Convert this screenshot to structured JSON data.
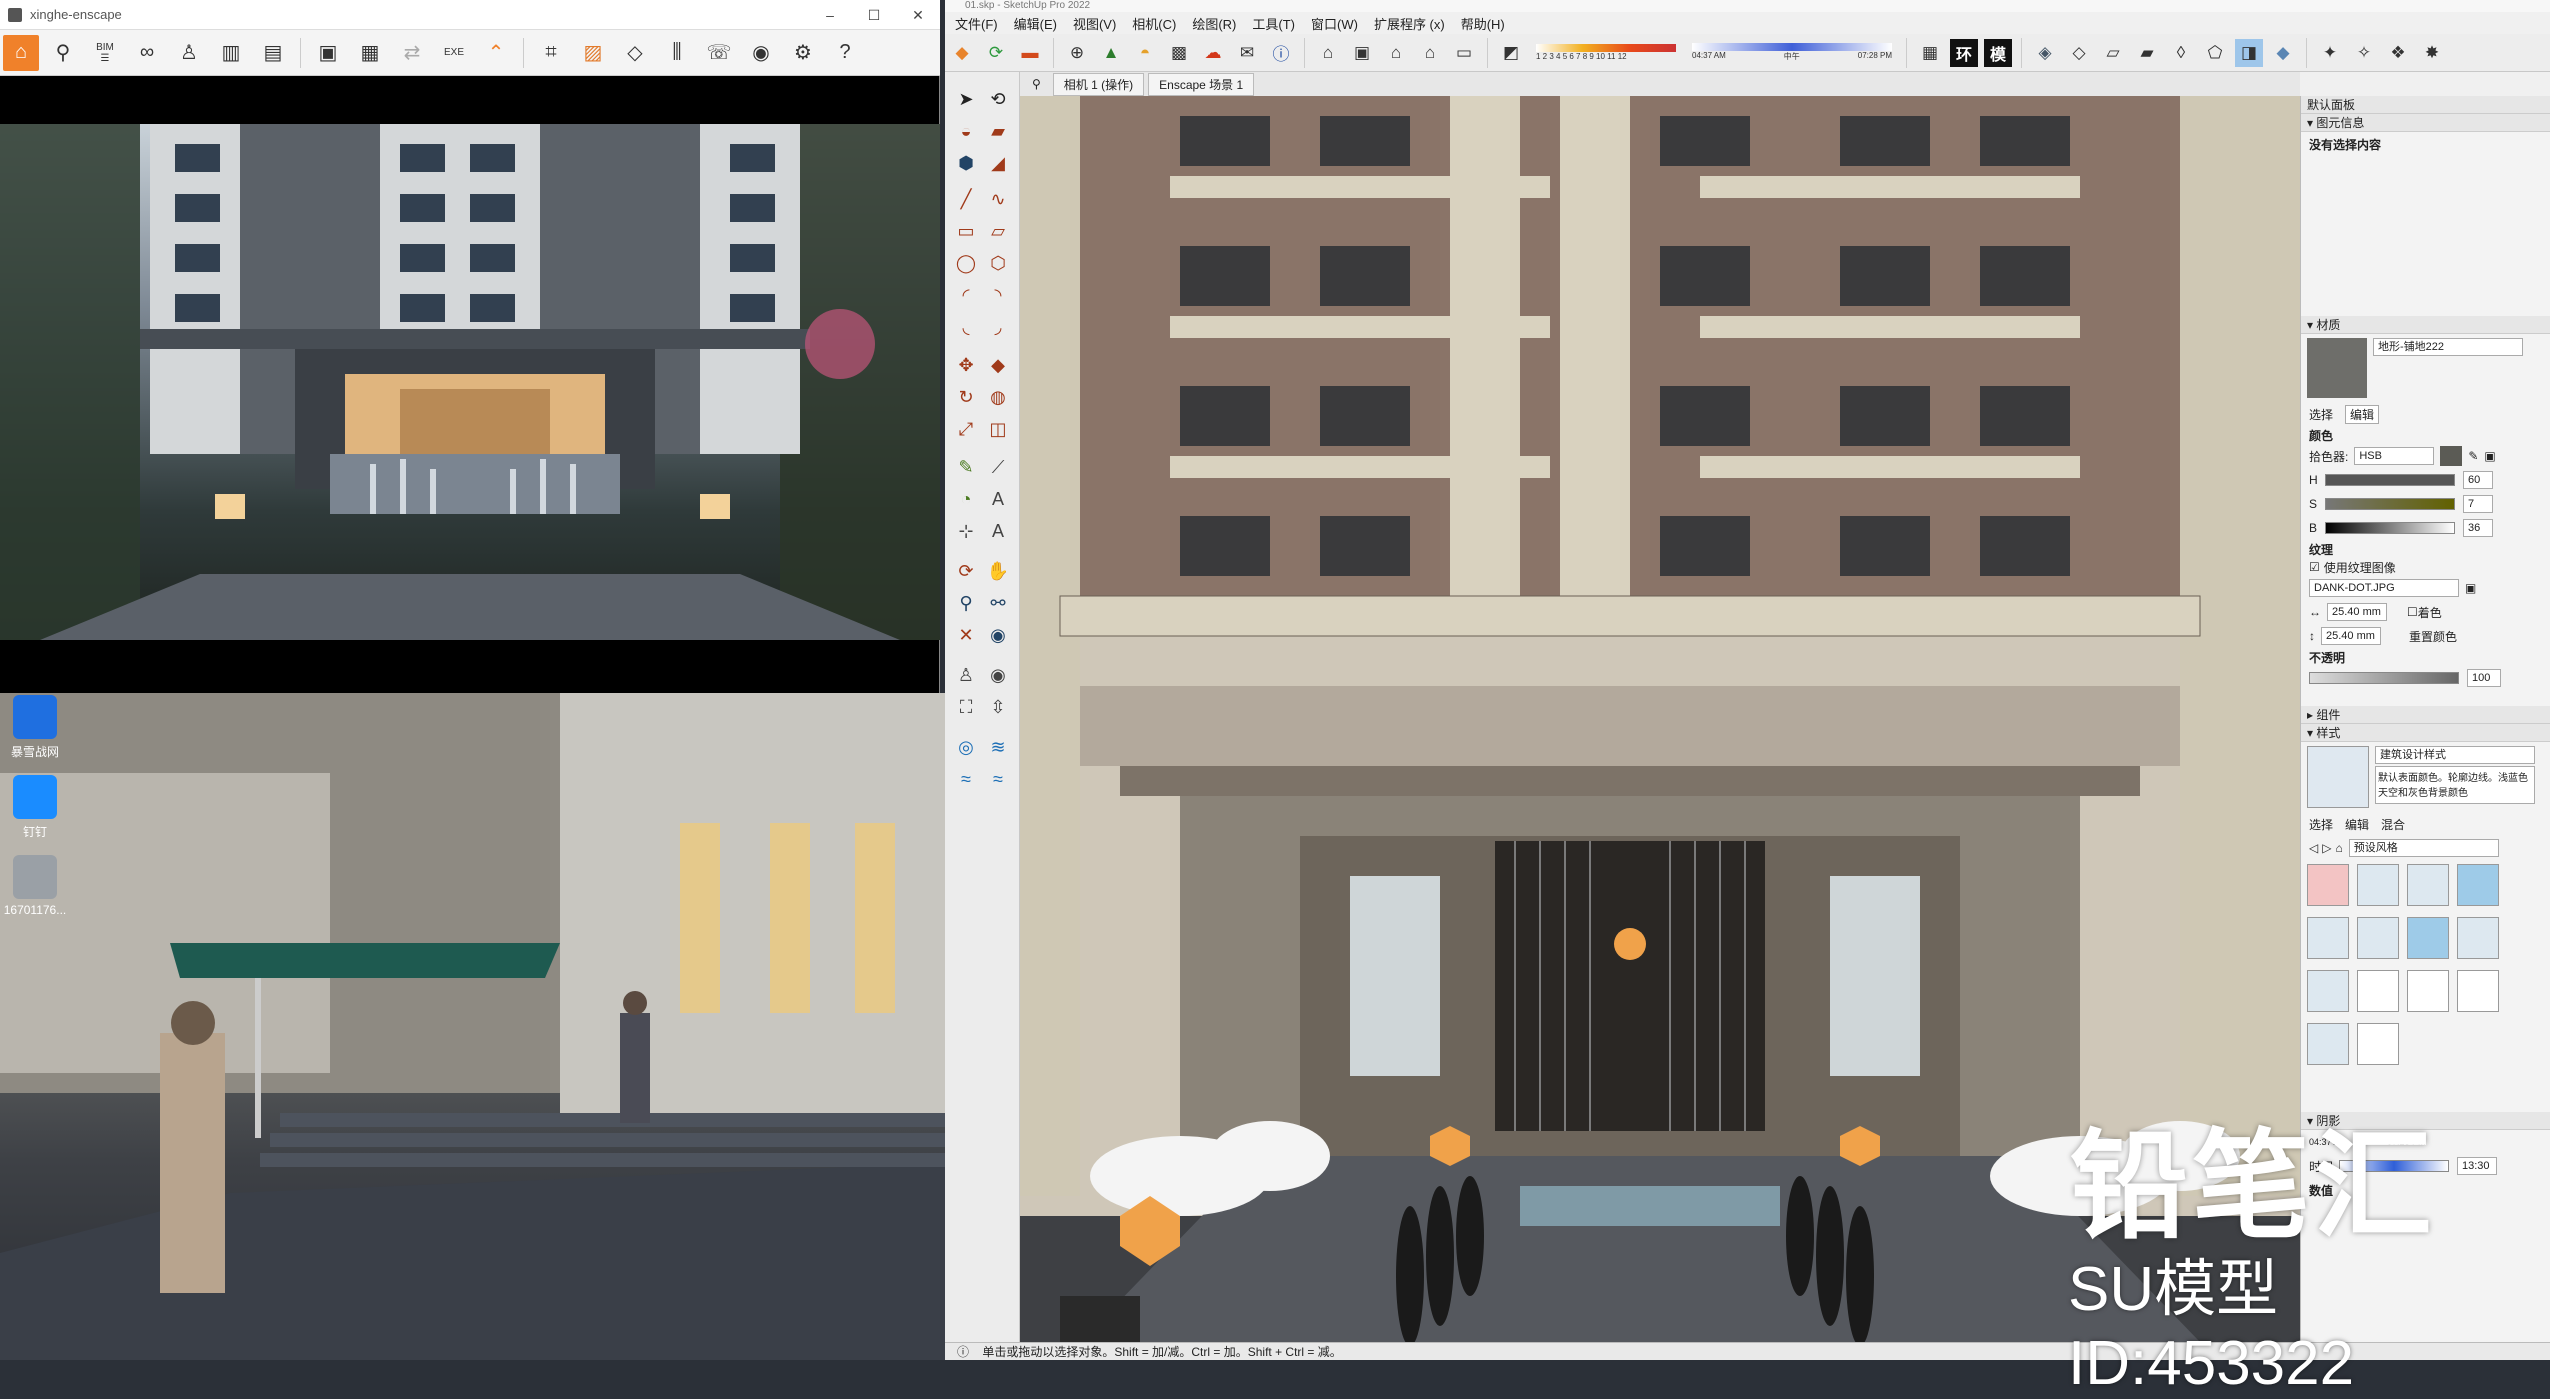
{
  "enscape": {
    "title": "xinghe-enscape",
    "minimize": "–",
    "maximize": "☐",
    "close": "✕",
    "toolbar_icons": [
      "home-icon",
      "pin-icon",
      "bim-icon",
      "binoculars-icon",
      "person-icon",
      "building-icon",
      "clapper-icon",
      "screenshot-icon",
      "batch-render-icon",
      "panorama-icon",
      "exe-export-icon",
      "collapse-icon",
      "map-icon",
      "asset-library-icon",
      "cube-icon",
      "library-icon",
      "chat-icon",
      "eye-icon",
      "gear-icon",
      "help-icon"
    ],
    "bim_label": "BIM",
    "exe_label": "EXE"
  },
  "desktop": {
    "icons": [
      {
        "label": "暴雪战网"
      },
      {
        "label": "钉钉"
      },
      {
        "label": "16701176..."
      }
    ]
  },
  "sketchup": {
    "title": "01.skp - SketchUp Pro 2022",
    "menu": [
      "文件(F)",
      "编辑(E)",
      "视图(V)",
      "相机(C)",
      "绘图(R)",
      "工具(T)",
      "窗口(W)",
      "扩展程序 (x)",
      "帮助(H)"
    ],
    "scene_tabs": [
      "相机 1 (操作)",
      "Enscape 场景 1"
    ],
    "time_labels": {
      "months": "1  2  3  4  5  6  7  8  9  10  11  12",
      "start": "04:37 AM",
      "mid": "中午",
      "end": "07:28 PM"
    },
    "toolbar_letters": [
      "环",
      "模"
    ],
    "status": "单击或拖动以选择对象。Shift = 加/减。Ctrl = 加。Shift + Ctrl = 减。"
  },
  "tray": {
    "title": "默认面板",
    "entity_info": {
      "header": "图元信息",
      "text": "没有选择内容"
    },
    "materials": {
      "header": "材质",
      "name": "地形-铺地222",
      "tabs": [
        "选择",
        "编辑"
      ],
      "color_label": "颜色",
      "picker_label": "拾色器:",
      "picker_value": "HSB",
      "h": {
        "label": "H",
        "value": "60"
      },
      "s": {
        "label": "S",
        "value": "7"
      },
      "b": {
        "label": "B",
        "value": "36"
      },
      "texture_label": "纹理",
      "use_texture": "使用纹理图像",
      "texture_file": "DANK-DOT.JPG",
      "width": "25.40 mm",
      "height": "25.40 mm",
      "colorize": "着色",
      "reset_color": "重置颜色",
      "opacity_label": "不透明",
      "opacity_value": "100"
    },
    "components": {
      "header": "组件"
    },
    "styles": {
      "header": "样式",
      "name": "建筑设计样式",
      "desc": "默认表面颜色。轮廓边线。浅蓝色天空和灰色背景颜色",
      "tabs": [
        "选择",
        "编辑",
        "混合"
      ],
      "dropdown": "预设风格"
    },
    "shadows": {
      "header": "阴影",
      "time_label": "时间",
      "time_start": "04:37 AM",
      "time_end": "07:28 PM",
      "time_value": "13:30"
    },
    "footer": "数值"
  },
  "watermark": {
    "logo": "铅笔汇",
    "id": "SU模型ID:453322"
  }
}
